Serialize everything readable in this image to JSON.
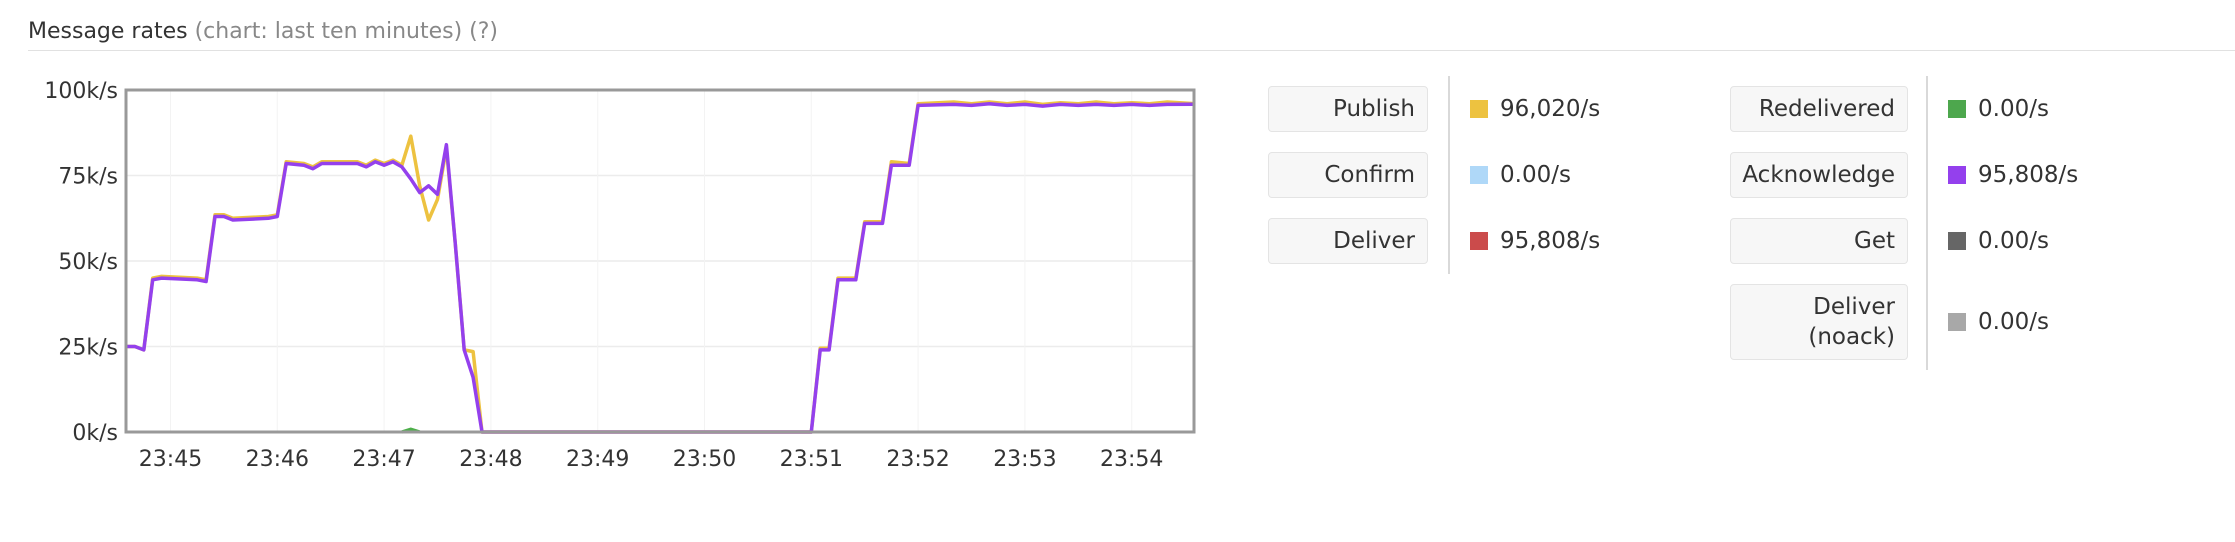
{
  "header": {
    "title": "Message rates",
    "subtitle": "(chart: last ten minutes)",
    "help": "(?)"
  },
  "chart_data": {
    "type": "line",
    "ylim": [
      0,
      100000
    ],
    "y_ticks": [
      "0k/s",
      "25k/s",
      "50k/s",
      "75k/s",
      "100k/s"
    ],
    "y_tick_values": [
      0,
      25000,
      50000,
      75000,
      100000
    ],
    "x_ticks": [
      "23:45",
      "23:46",
      "23:47",
      "23:48",
      "23:49",
      "23:50",
      "23:51",
      "23:52",
      "23:53",
      "23:54"
    ],
    "xlim": [
      "23:44:35",
      "23:54:35"
    ],
    "grid": true,
    "series": [
      {
        "name": "Publish",
        "color": "#edc240",
        "points": [
          [
            "23:44:35",
            25000
          ],
          [
            "23:44:40",
            25000
          ],
          [
            "23:44:45",
            24000
          ],
          [
            "23:44:50",
            45000
          ],
          [
            "23:44:55",
            45500
          ],
          [
            "23:45:15",
            45000
          ],
          [
            "23:45:20",
            44500
          ],
          [
            "23:45:25",
            63500
          ],
          [
            "23:45:30",
            63500
          ],
          [
            "23:45:35",
            62500
          ],
          [
            "23:45:55",
            63000
          ],
          [
            "23:46:00",
            63500
          ],
          [
            "23:46:05",
            79000
          ],
          [
            "23:46:15",
            78500
          ],
          [
            "23:46:20",
            77500
          ],
          [
            "23:46:25",
            79000
          ],
          [
            "23:46:45",
            79000
          ],
          [
            "23:46:50",
            78000
          ],
          [
            "23:46:55",
            79500
          ],
          [
            "23:47:00",
            78500
          ],
          [
            "23:47:05",
            79500
          ],
          [
            "23:47:10",
            78000
          ],
          [
            "23:47:15",
            86500
          ],
          [
            "23:47:20",
            72000
          ],
          [
            "23:47:25",
            62000
          ],
          [
            "23:47:30",
            68000
          ],
          [
            "23:47:35",
            83000
          ],
          [
            "23:47:40",
            55000
          ],
          [
            "23:47:45",
            24000
          ],
          [
            "23:47:50",
            23500
          ],
          [
            "23:47:55",
            0
          ],
          [
            "23:51:00",
            0
          ],
          [
            "23:51:05",
            24500
          ],
          [
            "23:51:10",
            24500
          ],
          [
            "23:51:15",
            45000
          ],
          [
            "23:51:25",
            45000
          ],
          [
            "23:51:30",
            61500
          ],
          [
            "23:51:40",
            61500
          ],
          [
            "23:51:45",
            79000
          ],
          [
            "23:51:55",
            78500
          ],
          [
            "23:52:00",
            96000
          ],
          [
            "23:52:20",
            96500
          ],
          [
            "23:52:30",
            96000
          ],
          [
            "23:52:40",
            96500
          ],
          [
            "23:52:50",
            96000
          ],
          [
            "23:53:00",
            96500
          ],
          [
            "23:53:10",
            95800
          ],
          [
            "23:53:20",
            96300
          ],
          [
            "23:53:30",
            96000
          ],
          [
            "23:53:40",
            96500
          ],
          [
            "23:53:50",
            96000
          ],
          [
            "23:54:00",
            96300
          ],
          [
            "23:54:10",
            96000
          ],
          [
            "23:54:20",
            96500
          ],
          [
            "23:54:35",
            96020
          ]
        ]
      },
      {
        "name": "Acknowledge",
        "color": "#9440ed",
        "points": [
          [
            "23:44:35",
            25000
          ],
          [
            "23:44:40",
            25000
          ],
          [
            "23:44:45",
            24000
          ],
          [
            "23:44:50",
            44500
          ],
          [
            "23:44:55",
            45000
          ],
          [
            "23:45:15",
            44500
          ],
          [
            "23:45:20",
            44000
          ],
          [
            "23:45:25",
            63000
          ],
          [
            "23:45:30",
            63000
          ],
          [
            "23:45:35",
            62000
          ],
          [
            "23:45:55",
            62500
          ],
          [
            "23:46:00",
            63000
          ],
          [
            "23:46:05",
            78500
          ],
          [
            "23:46:15",
            78000
          ],
          [
            "23:46:20",
            77000
          ],
          [
            "23:46:25",
            78500
          ],
          [
            "23:46:45",
            78500
          ],
          [
            "23:46:50",
            77500
          ],
          [
            "23:46:55",
            79000
          ],
          [
            "23:47:00",
            78000
          ],
          [
            "23:47:05",
            79000
          ],
          [
            "23:47:10",
            77500
          ],
          [
            "23:47:15",
            74000
          ],
          [
            "23:47:20",
            70000
          ],
          [
            "23:47:25",
            72000
          ],
          [
            "23:47:30",
            69500
          ],
          [
            "23:47:35",
            84000
          ],
          [
            "23:47:40",
            55000
          ],
          [
            "23:47:45",
            24000
          ],
          [
            "23:47:50",
            16000
          ],
          [
            "23:47:55",
            0
          ],
          [
            "23:51:00",
            0
          ],
          [
            "23:51:05",
            24000
          ],
          [
            "23:51:10",
            24000
          ],
          [
            "23:51:15",
            44500
          ],
          [
            "23:51:25",
            44500
          ],
          [
            "23:51:30",
            61000
          ],
          [
            "23:51:40",
            61000
          ],
          [
            "23:51:45",
            78000
          ],
          [
            "23:51:55",
            78000
          ],
          [
            "23:52:00",
            95500
          ],
          [
            "23:52:20",
            95800
          ],
          [
            "23:52:30",
            95500
          ],
          [
            "23:52:40",
            96000
          ],
          [
            "23:52:50",
            95500
          ],
          [
            "23:53:00",
            95800
          ],
          [
            "23:53:10",
            95300
          ],
          [
            "23:53:20",
            95800
          ],
          [
            "23:53:30",
            95500
          ],
          [
            "23:53:40",
            95800
          ],
          [
            "23:53:50",
            95500
          ],
          [
            "23:54:00",
            95800
          ],
          [
            "23:54:10",
            95500
          ],
          [
            "23:54:20",
            95800
          ],
          [
            "23:54:35",
            95808
          ]
        ]
      },
      {
        "name": "Redelivered",
        "color": "#4daf4a",
        "points": [
          [
            "23:47:10",
            0
          ],
          [
            "23:47:15",
            800
          ],
          [
            "23:47:20",
            0
          ]
        ]
      }
    ]
  },
  "legend": {
    "left": [
      {
        "label": "Publish",
        "value": "96,020/s",
        "color": "#edc240"
      },
      {
        "label": "Confirm",
        "value": "0.00/s",
        "color": "#afd8f8"
      },
      {
        "label": "Deliver",
        "value": "95,808/s",
        "color": "#cb4b4b"
      }
    ],
    "right": [
      {
        "label": "Redelivered",
        "value": "0.00/s",
        "color": "#4da74d"
      },
      {
        "label": "Acknowledge",
        "value": "95,808/s",
        "color": "#9440ed"
      },
      {
        "label": "Get",
        "value": "0.00/s",
        "color": "#666666"
      },
      {
        "label": "Deliver (noack)",
        "value": "0.00/s",
        "color": "#a8a8a8"
      }
    ]
  }
}
